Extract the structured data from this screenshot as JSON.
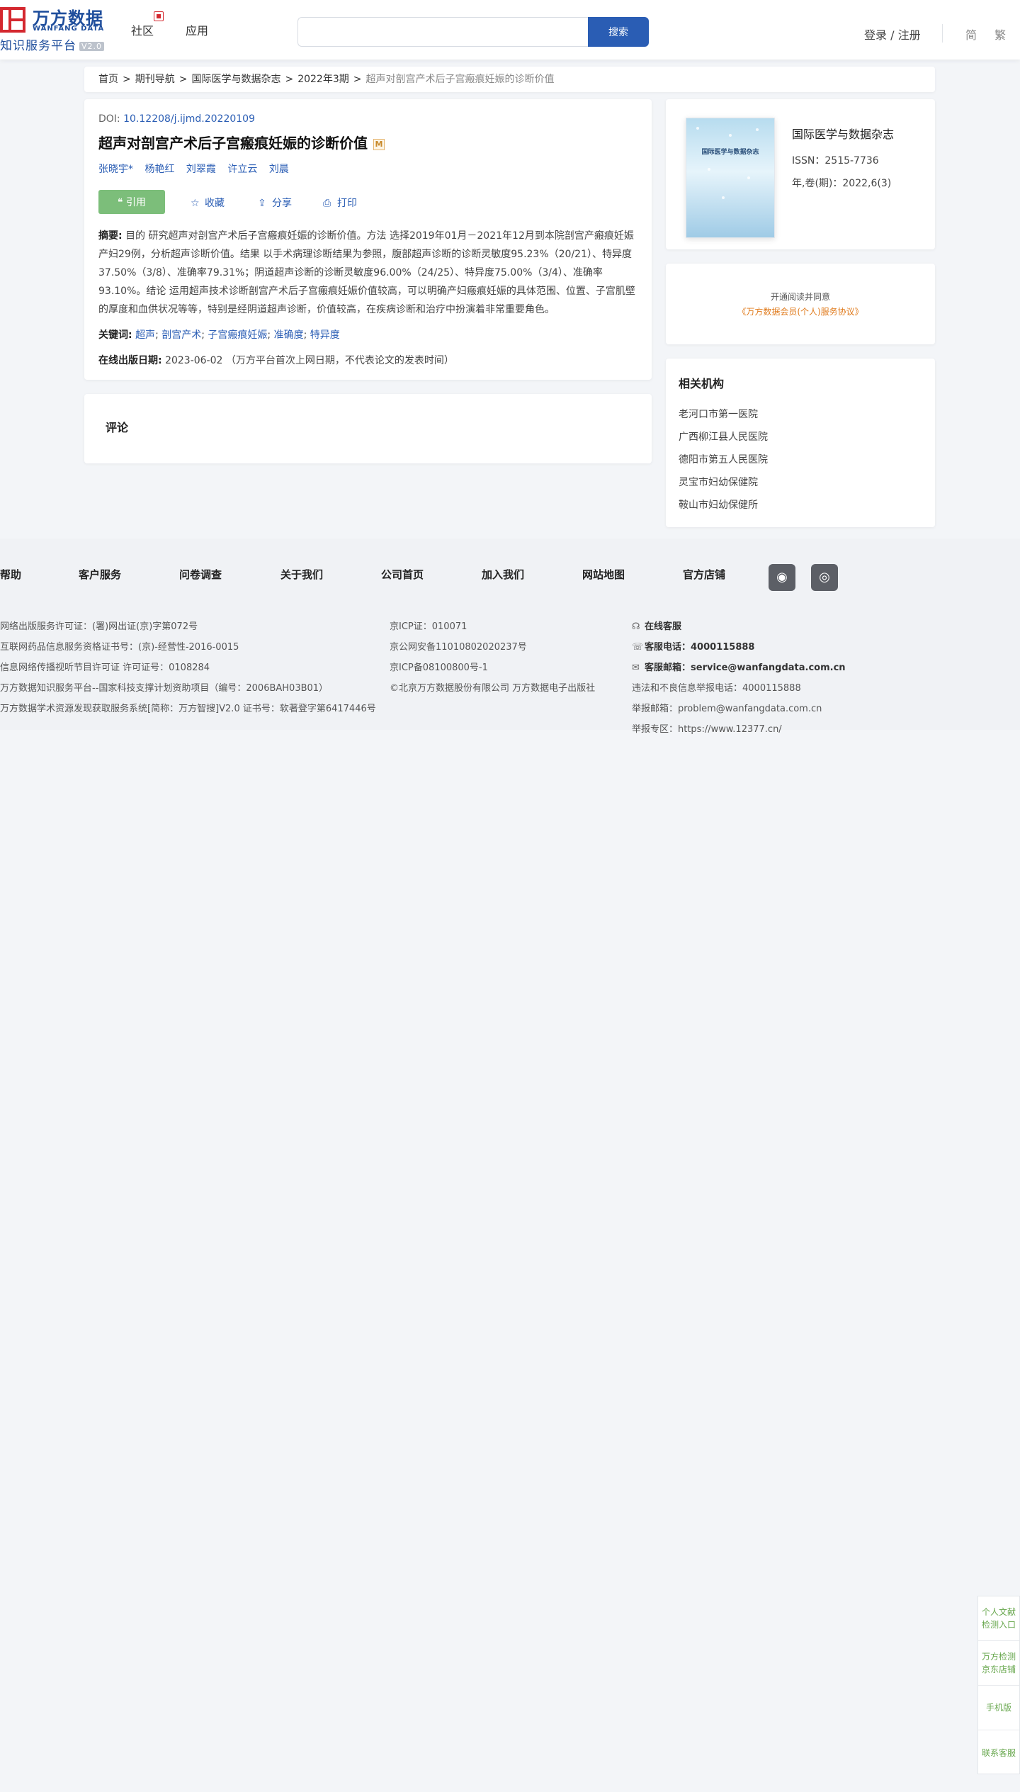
{
  "header": {
    "logo_cn": "万方数据",
    "logo_en": "WANFANG DATA",
    "logo_sub": "知识服务平台",
    "logo_ver": "V2.0",
    "nav": [
      "社区",
      "应用"
    ],
    "search_placeholder": "",
    "search_button": "搜索",
    "login": "登录 / 注册",
    "lang_simp": "简",
    "lang_trad": "繁"
  },
  "breadcrumb": [
    "首页",
    "期刊导航",
    "国际医学与数据杂志",
    "2022年3期",
    "超声对剖宫产术后子宫瘢痕妊娠的诊断价值"
  ],
  "article": {
    "doi_label": "DOI: ",
    "doi": "10.12208/j.ijmd.20220109",
    "title": "超声对剖宫产术后子宫瘢痕妊娠的诊断价值",
    "title_badge": "M",
    "authors": [
      "张晓宇*",
      "杨艳红",
      "刘翠霞",
      "许立云",
      "刘晨"
    ],
    "cite_button": "❝ 引用",
    "favorite": "收藏",
    "share": "分享",
    "print": "打印",
    "abstract_label": "摘要:",
    "abstract": "目的 研究超声对剖宫产术后子宫瘢痕妊娠的诊断价值。方法 选择2019年01月－2021年12月到本院剖宫产瘢痕妊娠产妇29例，分析超声诊断价值。结果 以手术病理诊断结果为参照，腹部超声诊断的诊断灵敏度95.23%（20/21）、特异度37.50%（3/8）、准确率79.31%；阴道超声诊断的诊断灵敏度96.00%（24/25）、特异度75.00%（3/4）、准确率93.10%。结论 运用超声技术诊断剖宫产术后子宫瘢痕妊娠价值较高，可以明确产妇瘢痕妊娠的具体范围、位置、子宫肌壁的厚度和血供状况等等，特别是经阴道超声诊断，价值较高，在疾病诊断和治疗中扮演着非常重要角色。",
    "keywords_label": "关键词:",
    "keywords": [
      "超声",
      "剖宫产术",
      "子宫瘢痕妊娠",
      "准确度",
      "特异度"
    ],
    "pubdate_label": "在线出版日期:",
    "pubdate": "2023-06-02",
    "pubdate_note": "（万方平台首次上网日期，不代表论文的发表时间）"
  },
  "comment": {
    "title": "评论"
  },
  "journal": {
    "cover_title": "国际医学与数据杂志",
    "name": "国际医学与数据杂志",
    "issn": "ISSN：2515-7736",
    "volume": "年,卷(期)：2022,6(3)"
  },
  "agreement": {
    "line1": "开通阅读并同意",
    "line2": "《万方数据会员(个人)服务协议》"
  },
  "orgs": {
    "title": "相关机构",
    "items": [
      "老河口市第一医院",
      "广西柳江县人民医院",
      "德阳市第五人民医院",
      "灵宝市妇幼保健院",
      "鞍山市妇幼保健所"
    ]
  },
  "footer": {
    "nav": [
      "帮助",
      "客户服务",
      "问卷调查",
      "关于我们",
      "公司首页",
      "加入我们",
      "网站地图",
      "官方店铺"
    ],
    "col1": [
      "网络出版服务许可证：(署)网出证(京)字第072号",
      "互联网药品信息服务资格证书号：(京)-经营性-2016-0015",
      "信息网络传播视听节目许可证 许可证号：0108284",
      "万方数据知识服务平台--国家科技支撑计划资助项目（编号：2006BAH03B01）",
      "万方数据学术资源发现获取服务系统[简称：万方智搜]V2.0 证书号：软著登字第6417446号"
    ],
    "col2": [
      "京ICP证：010071",
      "京公网安备11010802020237号",
      "京ICP备08100800号-1",
      "©北京万方数据股份有限公司 万方数据电子出版社"
    ],
    "online_service": "在线客服",
    "phone_label": "客服电话：",
    "phone": "4000115888",
    "email_label": "客服邮箱：",
    "email": "service@wanfangdata.com.cn",
    "report_phone": "违法和不良信息举报电话：4000115888",
    "report_email": "举报邮箱：problem@wanfangdata.com.cn",
    "report_zone": "举报专区：https://www.12377.cn/"
  },
  "float_bar": [
    "个人文献检测入口",
    "万方检测京东店铺",
    "手机版",
    "联系客服"
  ],
  "colors": {
    "brand_blue": "#2a5db4",
    "brand_red": "#d4282f",
    "cite_green": "#7cbe7a",
    "float_green": "#69a84f"
  }
}
